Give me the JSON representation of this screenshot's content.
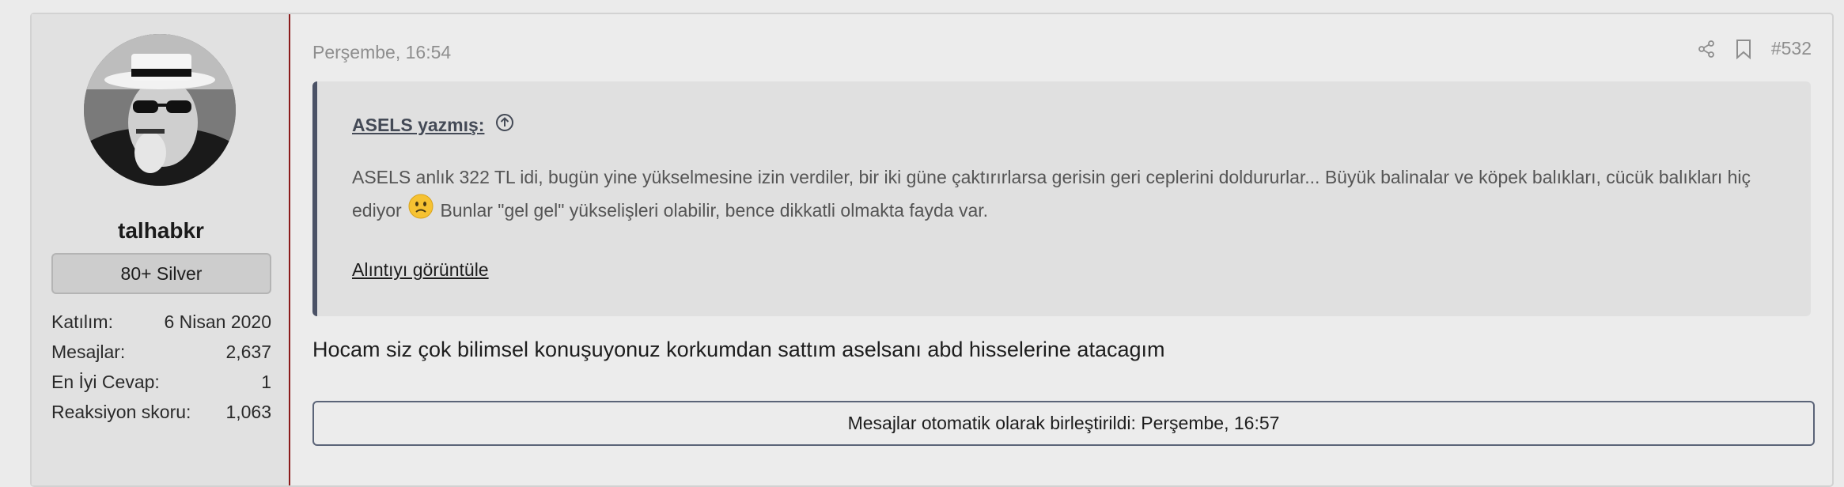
{
  "user": {
    "username": "talhabkr",
    "badge": "80+ Silver",
    "stats": [
      {
        "label": "Katılım:",
        "value": "6 Nisan 2020"
      },
      {
        "label": "Mesajlar:",
        "value": "2,637"
      },
      {
        "label": "En İyi Cevap:",
        "value": "1"
      },
      {
        "label": "Reaksiyon skoru:",
        "value": "1,063"
      }
    ]
  },
  "post": {
    "date": "Perşembe, 16:54",
    "number": "#532",
    "quote": {
      "attribution": "ASELS yazmış:",
      "text_before_emoji": "ASELS anlık 322 TL idi, bugün yine yükselmesine izin verdiler, bir iki güne çaktırırlarsa gerisin geri ceplerini doldururlar... Büyük balinalar ve köpek balıkları, cücük balıkları hiç ediyor",
      "text_after_emoji": "Bunlar \"gel gel\" yükselişleri olabilir, bence dikkatli olmakta fayda var.",
      "expand_label": "Alıntıyı görüntüle"
    },
    "message": "Hocam siz çok bilimsel konuşuyonuz korkumdan sattım aselsanı abd hisselerine atacagım",
    "merge_notice": "Mesajlar otomatik olarak birleştirildi: Perşembe, 16:57"
  },
  "icons": {
    "share": "share-icon",
    "bookmark": "bookmark-icon",
    "quote_link": "arrow-up-circle-icon",
    "emoji": "frowning-face-emoji"
  },
  "colors": {
    "quote_border": "#4b5266",
    "user_panel_border": "#8a1a1a",
    "emoji": "#f6c232"
  }
}
